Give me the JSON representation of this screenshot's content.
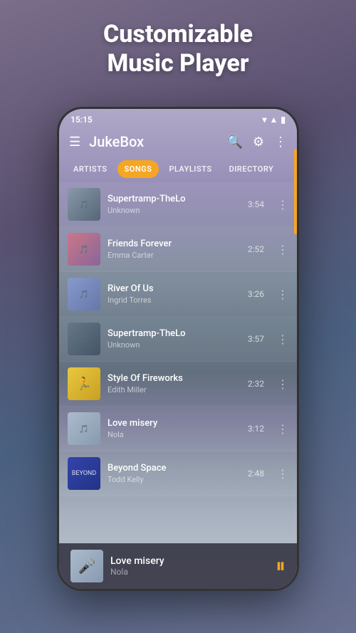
{
  "hero": {
    "title": "Customizable\nMusic Player"
  },
  "status_bar": {
    "time": "15:15",
    "signal": "▼▲",
    "wifi": "WiFi",
    "battery": "Battery"
  },
  "app_bar": {
    "title": "JukeBox"
  },
  "tabs": [
    {
      "label": "ARTISTS",
      "active": false
    },
    {
      "label": "SONGS",
      "active": true
    },
    {
      "label": "PLAYLISTS",
      "active": false
    },
    {
      "label": "DIRECTORY",
      "active": false
    }
  ],
  "songs": [
    {
      "title": "Supertramp-TheLo",
      "artist": "Unknown",
      "duration": "3:54",
      "thumb_class": "thumb-1"
    },
    {
      "title": "Friends Forever",
      "artist": "Emma Carter",
      "duration": "2:52",
      "thumb_class": "thumb-2"
    },
    {
      "title": "River Of Us",
      "artist": "Ingrid Torres",
      "duration": "3:26",
      "thumb_class": "thumb-3"
    },
    {
      "title": "Supertramp-TheLo",
      "artist": "Unknown",
      "duration": "3:57",
      "thumb_class": "thumb-4"
    },
    {
      "title": "Style Of Fireworks",
      "artist": "Edith Miller",
      "duration": "2:32",
      "thumb_class": "thumb-5"
    },
    {
      "title": "Love misery",
      "artist": "Nola",
      "duration": "3:12",
      "thumb_class": "thumb-6"
    },
    {
      "title": "Beyond Space",
      "artist": "Todd Kelly",
      "duration": "2:48",
      "thumb_class": "thumb-7"
    }
  ],
  "now_playing": {
    "title": "Love misery",
    "artist": "Nola",
    "is_playing": true
  },
  "colors": {
    "accent": "#f5a623",
    "bg_dark": "rgba(60,60,75,0.95)",
    "text_primary": "#ffffff",
    "text_secondary": "rgba(255,255,255,0.6)"
  }
}
